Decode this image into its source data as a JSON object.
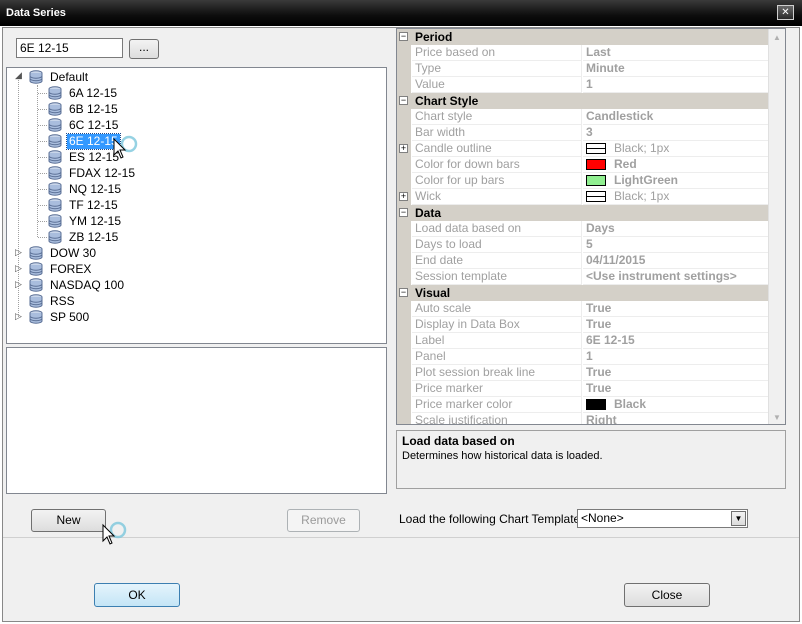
{
  "window": {
    "title": "Data Series"
  },
  "search": {
    "value": "6E 12-15",
    "browse_label": "..."
  },
  "tree": {
    "root": "Default",
    "children": [
      "6A 12-15",
      "6B 12-15",
      "6C 12-15",
      "6E 12-15",
      "ES 12-15",
      "FDAX 12-15",
      "NQ 12-15",
      "TF 12-15",
      "YM 12-15",
      "ZB 12-15"
    ],
    "selected": "6E 12-15",
    "groups": [
      "DOW 30",
      "FOREX",
      "NASDAQ 100",
      "RSS",
      "SP 500"
    ]
  },
  "buttons": {
    "new": "New",
    "remove": "Remove",
    "ok": "OK",
    "close": "Close"
  },
  "properties": {
    "period": {
      "title": "Period",
      "rows": [
        {
          "name": "Price based on",
          "value": "Last"
        },
        {
          "name": "Type",
          "value": "Minute"
        },
        {
          "name": "Value",
          "value": "1"
        }
      ]
    },
    "chart_style": {
      "title": "Chart Style",
      "rows": [
        {
          "name": "Chart style",
          "value": "Candlestick"
        },
        {
          "name": "Bar width",
          "value": "3"
        },
        {
          "name": "Candle outline",
          "value": "Black; 1px",
          "swatch": "#ffffff"
        },
        {
          "name": "Color for down bars",
          "value": "Red",
          "swatch": "#ff0000"
        },
        {
          "name": "Color for up bars",
          "value": "LightGreen",
          "swatch": "#90ee90"
        },
        {
          "name": "Wick",
          "value": "Black; 1px",
          "swatch": "#ffffff"
        }
      ]
    },
    "data": {
      "title": "Data",
      "rows": [
        {
          "name": "Load data based on",
          "value": "Days"
        },
        {
          "name": "Days to load",
          "value": "5"
        },
        {
          "name": "End date",
          "value": "04/11/2015"
        },
        {
          "name": "Session template",
          "value": "<Use instrument settings>"
        }
      ]
    },
    "visual": {
      "title": "Visual",
      "rows": [
        {
          "name": "Auto scale",
          "value": "True"
        },
        {
          "name": "Display in Data Box",
          "value": "True"
        },
        {
          "name": "Label",
          "value": "6E 12-15"
        },
        {
          "name": "Panel",
          "value": "1"
        },
        {
          "name": "Plot session break line",
          "value": "True"
        },
        {
          "name": "Price marker",
          "value": "True"
        },
        {
          "name": "Price marker color",
          "value": "Black",
          "swatch": "#000000"
        },
        {
          "name": "Scale justification",
          "value": "Right"
        }
      ]
    }
  },
  "help": {
    "title": "Load data based on",
    "text": "Determines how historical data is loaded."
  },
  "template": {
    "label": "Load the following Chart Template:",
    "value": "<None>"
  },
  "colors": {
    "selection": "#3399ff",
    "category_bg": "#d4d0c8"
  }
}
